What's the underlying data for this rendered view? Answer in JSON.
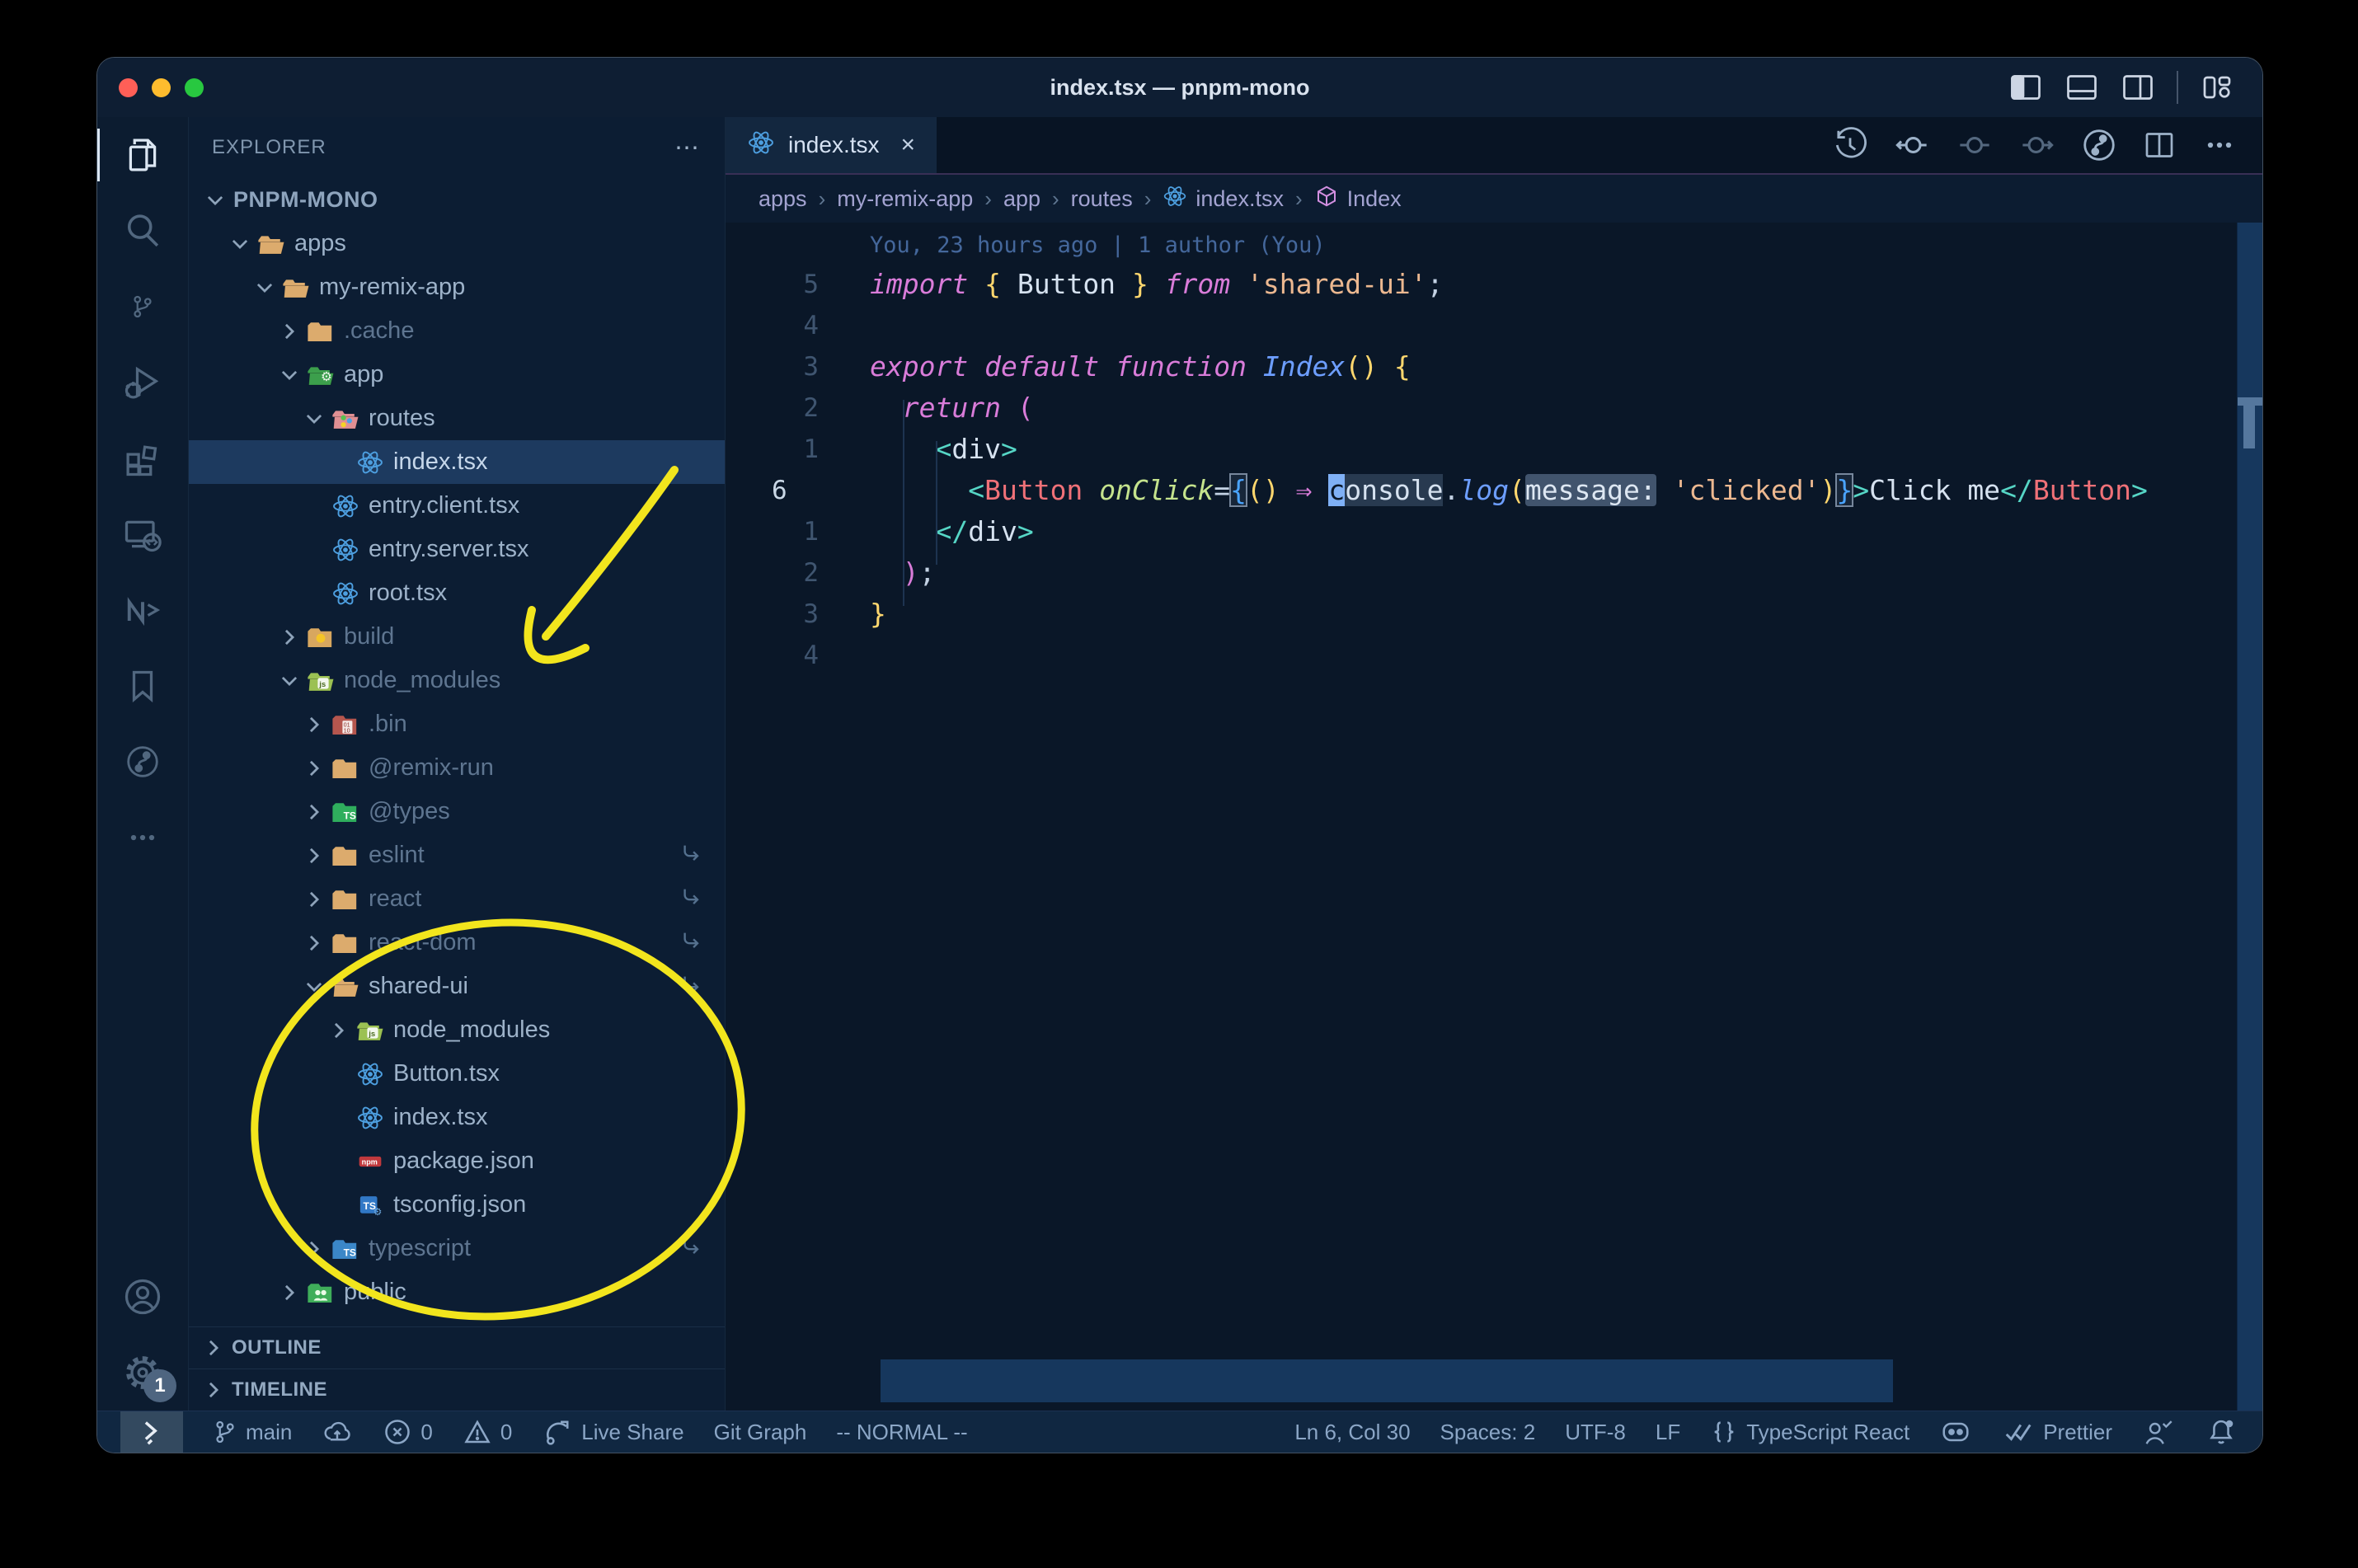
{
  "window": {
    "title": "index.tsx — pnpm-mono"
  },
  "colors": {
    "annotation_yellow": "#f2e51d",
    "selection_row": "#1d3a5f",
    "traffic_red": "#ff5f57",
    "traffic_yellow": "#febc2e",
    "traffic_green": "#28c840",
    "cursor_blue": "#7fb0f5",
    "statusbar_bg": "#102741",
    "editor_bg": "#0a1728"
  },
  "titlebar_icons": [
    {
      "name": "panel-left-icon"
    },
    {
      "name": "panel-bottom-icon"
    },
    {
      "name": "panel-right-icon"
    },
    {
      "name": "layout-customize-icon"
    }
  ],
  "activity_bar": {
    "items": [
      {
        "name": "explorer",
        "icon": "files-icon",
        "active": true
      },
      {
        "name": "search",
        "icon": "search-icon"
      },
      {
        "name": "source-control",
        "icon": "git-branch-icon"
      },
      {
        "name": "run-debug",
        "icon": "debug-icon"
      },
      {
        "name": "extensions",
        "icon": "extensions-icon"
      },
      {
        "name": "remote-explorer",
        "icon": "remote-explorer-icon"
      },
      {
        "name": "nx-console",
        "icon": "nx-icon"
      },
      {
        "name": "bookmarks",
        "icon": "bookmark-icon"
      },
      {
        "name": "git-graph",
        "icon": "git-graph-icon"
      },
      {
        "name": "more-views",
        "icon": "ellipsis-icon"
      }
    ],
    "bottom_items": [
      {
        "name": "accounts",
        "icon": "account-icon"
      },
      {
        "name": "settings",
        "icon": "gear-icon",
        "badge": "1"
      }
    ]
  },
  "explorer": {
    "header": "EXPLORER",
    "header_more": "⋯",
    "rows": [
      {
        "label": "PNPM-MONO",
        "indent": 0,
        "chevron": "down",
        "icon": null,
        "root": true
      },
      {
        "label": "apps",
        "indent": 1,
        "chevron": "down",
        "icon": "folder-tan-open"
      },
      {
        "label": "my-remix-app",
        "indent": 2,
        "chevron": "down",
        "icon": "folder-tan-open"
      },
      {
        "label": ".cache",
        "indent": 3,
        "chevron": "right",
        "icon": "folder-tan",
        "dim": true
      },
      {
        "label": "app",
        "indent": 3,
        "chevron": "down",
        "icon": "folder-app"
      },
      {
        "label": "routes",
        "indent": 4,
        "chevron": "down",
        "icon": "folder-routes"
      },
      {
        "label": "index.tsx",
        "indent": 5,
        "chevron": "none",
        "icon": "react",
        "selected": true
      },
      {
        "label": "entry.client.tsx",
        "indent": 4,
        "chevron": "none",
        "icon": "react"
      },
      {
        "label": "entry.server.tsx",
        "indent": 4,
        "chevron": "none",
        "icon": "react"
      },
      {
        "label": "root.tsx",
        "indent": 4,
        "chevron": "none",
        "icon": "react"
      },
      {
        "label": "build",
        "indent": 3,
        "chevron": "right",
        "icon": "folder-build",
        "dim": true
      },
      {
        "label": "node_modules",
        "indent": 3,
        "chevron": "down",
        "icon": "folder-node",
        "dim": true
      },
      {
        "label": ".bin",
        "indent": 4,
        "chevron": "right",
        "icon": "folder-bin",
        "dim": true
      },
      {
        "label": "@remix-run",
        "indent": 4,
        "chevron": "right",
        "icon": "folder-tan",
        "dim": true
      },
      {
        "label": "@types",
        "indent": 4,
        "chevron": "right",
        "icon": "folder-types",
        "dim": true
      },
      {
        "label": "eslint",
        "indent": 4,
        "chevron": "right",
        "icon": "folder-tan",
        "dim": true,
        "symlink": true
      },
      {
        "label": "react",
        "indent": 4,
        "chevron": "right",
        "icon": "folder-tan",
        "dim": true,
        "symlink": true
      },
      {
        "label": "react-dom",
        "indent": 4,
        "chevron": "right",
        "icon": "folder-tan",
        "dim": true,
        "symlink": true
      },
      {
        "label": "shared-ui",
        "indent": 4,
        "chevron": "down",
        "icon": "folder-tan-open",
        "symlink": true
      },
      {
        "label": "node_modules",
        "indent": 5,
        "chevron": "right",
        "icon": "folder-node"
      },
      {
        "label": "Button.tsx",
        "indent": 5,
        "chevron": "none",
        "icon": "react"
      },
      {
        "label": "index.tsx",
        "indent": 5,
        "chevron": "none",
        "icon": "react"
      },
      {
        "label": "package.json",
        "indent": 5,
        "chevron": "none",
        "icon": "npm"
      },
      {
        "label": "tsconfig.json",
        "indent": 5,
        "chevron": "none",
        "icon": "tsjson"
      },
      {
        "label": "typescript",
        "indent": 4,
        "chevron": "right",
        "icon": "folder-ts",
        "dim": true,
        "symlink": true
      },
      {
        "label": "public",
        "indent": 3,
        "chevron": "right",
        "icon": "folder-public"
      }
    ],
    "sections": [
      "OUTLINE",
      "TIMELINE"
    ]
  },
  "tabs": [
    {
      "label": "index.tsx",
      "icon": "react",
      "active": true,
      "close": "×"
    }
  ],
  "editor_actions": [
    {
      "name": "timeline-history",
      "icon": "history-icon"
    },
    {
      "name": "gitlens-compare-prev",
      "icon": "circle-arrow-left-icon"
    },
    {
      "name": "gitlens-annotate",
      "icon": "circle-plain-icon",
      "dim": true
    },
    {
      "name": "gitlens-compare-next",
      "icon": "circle-arrow-right-icon",
      "dim": true
    },
    {
      "name": "git-graph-view",
      "icon": "git-graph-icon"
    },
    {
      "name": "split-editor",
      "icon": "split-icon"
    },
    {
      "name": "more-actions",
      "icon": "ellipsis-icon"
    }
  ],
  "breadcrumbs": [
    {
      "label": "apps"
    },
    {
      "label": "my-remix-app"
    },
    {
      "label": "app"
    },
    {
      "label": "routes"
    },
    {
      "label": "index.tsx",
      "icon": "react"
    },
    {
      "label": "Index",
      "icon": "symbol-cube"
    }
  ],
  "editor": {
    "blame": "You, 23 hours ago | 1 author (You)",
    "lines": [
      {
        "num": "5",
        "tokens": [
          {
            "t": "import",
            "c": "kw"
          },
          {
            "t": " "
          },
          {
            "t": "{",
            "c": "by"
          },
          {
            "t": " "
          },
          {
            "t": "Button",
            "c": "var"
          },
          {
            "t": " "
          },
          {
            "t": "}",
            "c": "by"
          },
          {
            "t": " "
          },
          {
            "t": "from",
            "c": "kw"
          },
          {
            "t": " "
          },
          {
            "t": "'shared-ui'",
            "c": "str"
          },
          {
            "t": ";",
            "c": "pn"
          }
        ]
      },
      {
        "num": "4",
        "tokens": []
      },
      {
        "num": "3",
        "tokens": [
          {
            "t": "export",
            "c": "kw"
          },
          {
            "t": " "
          },
          {
            "t": "default",
            "c": "kw"
          },
          {
            "t": " "
          },
          {
            "t": "function",
            "c": "kw"
          },
          {
            "t": " "
          },
          {
            "t": "Index",
            "c": "fn"
          },
          {
            "t": "()",
            "c": "by"
          },
          {
            "t": " "
          },
          {
            "t": "{",
            "c": "by"
          }
        ]
      },
      {
        "num": "2",
        "tokens": [
          {
            "t": "  "
          },
          {
            "t": "return",
            "c": "kw"
          },
          {
            "t": " "
          },
          {
            "t": "(",
            "c": "bp"
          }
        ]
      },
      {
        "num": "1",
        "tokens": [
          {
            "t": "    "
          },
          {
            "t": "<",
            "c": "tag"
          },
          {
            "t": "div",
            "c": "txt"
          },
          {
            "t": ">",
            "c": "tag"
          }
        ]
      },
      {
        "num": "6",
        "current": true,
        "tokens": [
          {
            "t": "      "
          },
          {
            "t": "<",
            "c": "tag"
          },
          {
            "t": "Button",
            "c": "cmp"
          },
          {
            "t": " "
          },
          {
            "t": "onClick",
            "c": "attr"
          },
          {
            "t": "=",
            "c": "pn"
          },
          {
            "t": "{",
            "c": "bb",
            "box": true
          },
          {
            "t": "()",
            "c": "by"
          },
          {
            "t": " "
          },
          {
            "t": "⇒",
            "c": "arrow"
          },
          {
            "t": " "
          },
          {
            "t": "c",
            "c": "txt",
            "cursor": true
          },
          {
            "t": "onsole",
            "c": "txt",
            "hl": true
          },
          {
            "t": ".",
            "c": "pn"
          },
          {
            "t": "log",
            "c": "fn"
          },
          {
            "t": "(",
            "c": "by"
          },
          {
            "t": "message:",
            "c": "inlay",
            "hl": true
          },
          {
            "t": " "
          },
          {
            "t": "'clicked'",
            "c": "str"
          },
          {
            "t": ")",
            "c": "by"
          },
          {
            "t": "}",
            "c": "bb",
            "box": true
          },
          {
            "t": ">",
            "c": "tag"
          },
          {
            "t": "Click me",
            "c": "txt"
          },
          {
            "t": "</",
            "c": "tag"
          },
          {
            "t": "Button",
            "c": "cmp"
          },
          {
            "t": ">",
            "c": "tag"
          }
        ]
      },
      {
        "num": "1",
        "tokens": [
          {
            "t": "    "
          },
          {
            "t": "</",
            "c": "tag"
          },
          {
            "t": "div",
            "c": "txt"
          },
          {
            "t": ">",
            "c": "tag"
          }
        ]
      },
      {
        "num": "2",
        "tokens": [
          {
            "t": "  "
          },
          {
            "t": ")",
            "c": "bp"
          },
          {
            "t": ";",
            "c": "pn"
          }
        ]
      },
      {
        "num": "3",
        "tokens": [
          {
            "t": "}",
            "c": "by"
          }
        ]
      },
      {
        "num": "4",
        "tokens": []
      }
    ]
  },
  "status_bar": {
    "left": [
      {
        "name": "remote-indicator",
        "icon": "remote-icon",
        "label": "",
        "boxed": true
      },
      {
        "name": "git-branch",
        "icon": "git-branch-icon",
        "label": "main"
      },
      {
        "name": "sync-publish",
        "icon": "cloud-up-icon",
        "label": ""
      },
      {
        "name": "errors",
        "icon": "error-icon",
        "label": "0"
      },
      {
        "name": "warnings",
        "icon": "warning-icon",
        "label": "0"
      },
      {
        "name": "live-share",
        "icon": "live-share-icon",
        "label": "Live Share"
      },
      {
        "name": "git-graph",
        "icon": null,
        "label": "Git Graph"
      },
      {
        "name": "vim-mode",
        "icon": null,
        "label": "-- NORMAL --"
      }
    ],
    "right": [
      {
        "name": "cursor-position",
        "icon": null,
        "label": "Ln 6, Col 30"
      },
      {
        "name": "indentation",
        "icon": null,
        "label": "Spaces: 2"
      },
      {
        "name": "encoding",
        "icon": null,
        "label": "UTF-8"
      },
      {
        "name": "eol",
        "icon": null,
        "label": "LF"
      },
      {
        "name": "language-mode",
        "icon": "braces-icon",
        "label": "TypeScript React"
      },
      {
        "name": "copilot",
        "icon": "copilot-icon",
        "label": ""
      },
      {
        "name": "prettier",
        "icon": "prettier-icon",
        "label": "Prettier"
      },
      {
        "name": "feedback",
        "icon": "person-check-icon",
        "label": ""
      },
      {
        "name": "notifications",
        "icon": "bell-icon",
        "label": ""
      }
    ]
  }
}
